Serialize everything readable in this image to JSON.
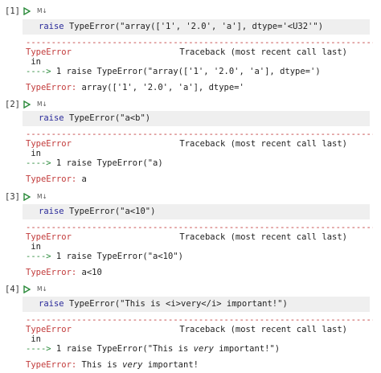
{
  "cells": [
    {
      "number": "[1]",
      "badge": "M↓",
      "code": {
        "kw": "raise",
        "cls": "TypeError",
        "arg": "(\"array(['1', '2.0', 'a'], dtype='<U32'\")"
      },
      "dashes": "---------------------------------------------------------------------------",
      "error_name": "TypeError",
      "traceback": "Traceback (most recent call last)",
      "in_line": " in",
      "arrow": "---->",
      "arrow_rest": " 1 raise TypeError(\"array(['1', '2.0', 'a'], dtype=')",
      "final_label": "TypeError:",
      "final_msg": " array(['1', '2.0', 'a'], dtype='"
    },
    {
      "number": "[2]",
      "badge": "M↓",
      "code": {
        "kw": "raise",
        "cls": "TypeError",
        "arg": "(\"a<b\")"
      },
      "dashes": "---------------------------------------------------------------------------",
      "error_name": "TypeError",
      "traceback": "Traceback (most recent call last)",
      "in_line": " in",
      "arrow": "---->",
      "arrow_rest": " 1 raise TypeError(\"a)",
      "final_label": "TypeError:",
      "final_msg": " a"
    },
    {
      "number": "[3]",
      "badge": "M↓",
      "code": {
        "kw": "raise",
        "cls": "TypeError",
        "arg": "(\"a<10\")"
      },
      "dashes": "---------------------------------------------------------------------------",
      "error_name": "TypeError",
      "traceback": "Traceback (most recent call last)",
      "in_line": " in",
      "arrow": "---->",
      "arrow_rest": " 1 raise TypeError(\"a<10\")",
      "final_label": "TypeError:",
      "final_msg": " a<10"
    },
    {
      "number": "[4]",
      "badge": "M↓",
      "code": {
        "kw": "raise",
        "cls": "TypeError",
        "arg": "(\"This is <i>very</i> important!\")"
      },
      "dashes": "---------------------------------------------------------------------------",
      "error_name": "TypeError",
      "traceback": "Traceback (most recent call last)",
      "in_line": " in",
      "arrow": "---->",
      "arrow_rest_pre": " 1 raise TypeError(\"This is ",
      "arrow_rest_italic": "very",
      "arrow_rest_post": " important!\")",
      "final_label": "TypeError:",
      "final_msg_pre": " This is ",
      "final_msg_italic": "very",
      "final_msg_post": " important!"
    }
  ],
  "colors": {
    "error": "#c23b3b",
    "arrow": "#2a8a3a",
    "run": "#2a8a3a",
    "code_bg": "#efefef"
  },
  "icons": {
    "run": "play-triangle-icon"
  }
}
